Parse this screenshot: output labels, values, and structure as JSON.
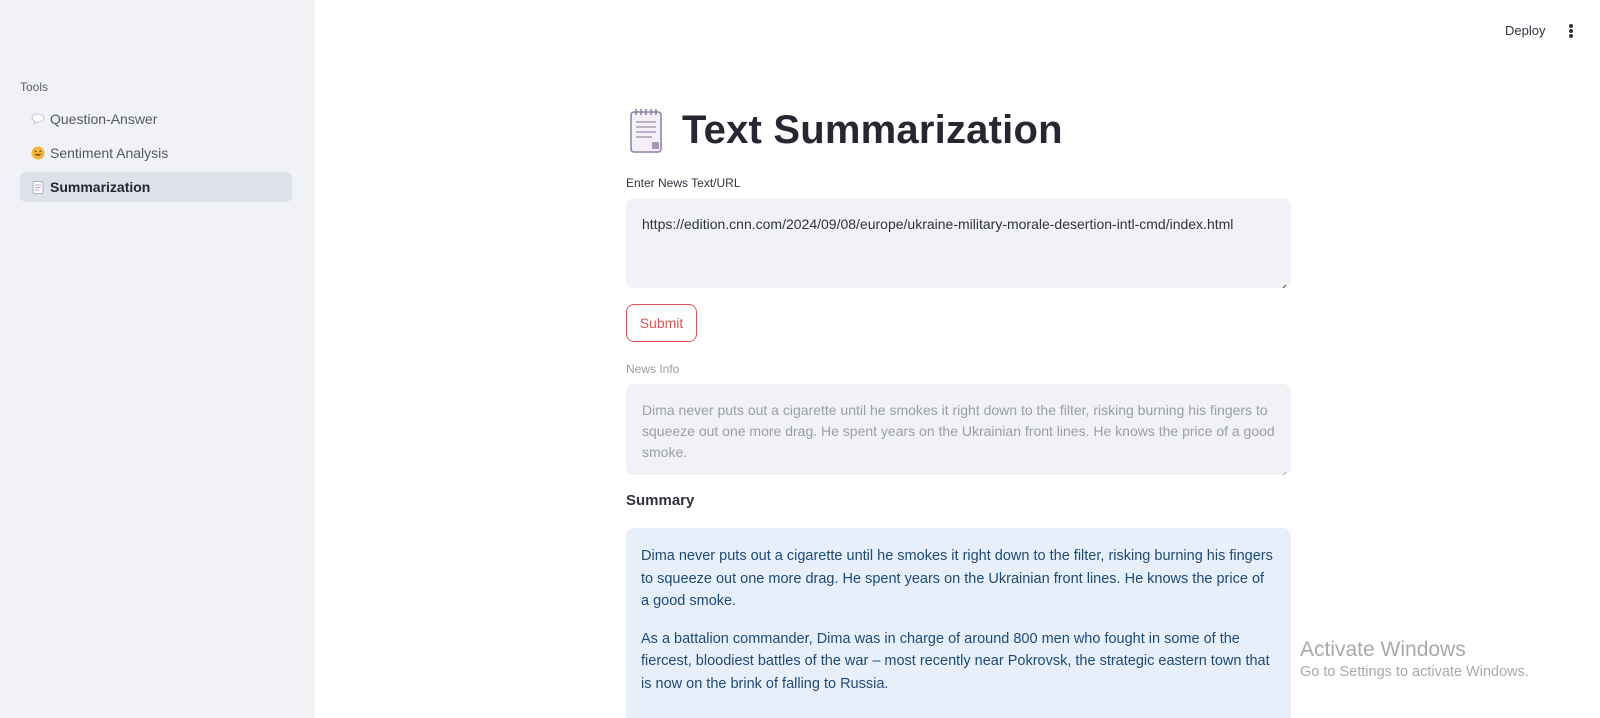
{
  "sidebar": {
    "heading": "Tools",
    "items": [
      {
        "label": "Question-Answer",
        "icon": "speech-bubble-icon",
        "active": false
      },
      {
        "label": "Sentiment Analysis",
        "icon": "grinning-face-icon",
        "active": false
      },
      {
        "label": "Summarization",
        "icon": "notepad-icon",
        "active": true
      }
    ]
  },
  "header": {
    "deploy_label": "Deploy",
    "menu_icon": "kebab-menu-icon"
  },
  "main": {
    "title": "Text Summarization",
    "title_icon": "notepad-icon",
    "input_label": "Enter News Text/URL",
    "input_value": "https://edition.cnn.com/2024/09/08/europe/ukraine-military-morale-desertion-intl-cmd/index.html",
    "submit_label": "Submit",
    "news_info_label": "News Info",
    "news_info_value": "Dima never puts out a cigarette until he smokes it right down to the filter, risking burning his fingers to squeeze out one more drag. He spent years on the Ukrainian front lines. He knows the price of a good smoke.",
    "summary_label": "Summary",
    "summary_paragraphs": [
      "Dima never puts out a cigarette until he smokes it right down to the filter, risking burning his fingers to squeeze out one more drag. He spent years on the Ukrainian front lines. He knows the price of a good smoke.",
      "As a battalion commander, Dima was in charge of around 800 men who fought in some of the fiercest, bloodiest battles of the war – most recently near Pokrovsk, the strategic eastern town that is now on the brink of falling to Russia."
    ]
  },
  "watermark": {
    "title": "Activate Windows",
    "subtitle": "Go to Settings to activate Windows."
  },
  "colors": {
    "sidebar_bg": "#f0f2f6",
    "accent_red": "#e35252",
    "summary_bg": "#e7f0fa",
    "summary_text": "#1e4a76"
  }
}
